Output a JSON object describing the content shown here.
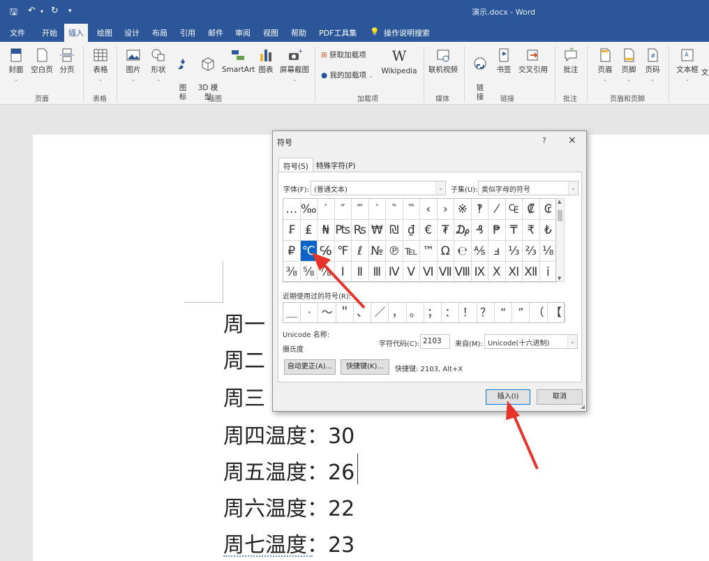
{
  "window": {
    "title": "演示.docx  -  Word",
    "quick_access": [
      "save-icon",
      "undo-icon",
      "redo-icon",
      "customize-icon"
    ]
  },
  "ribbon": {
    "tabs": [
      "文件",
      "开始",
      "插入",
      "绘图",
      "设计",
      "布局",
      "引用",
      "邮件",
      "审阅",
      "视图",
      "帮助",
      "PDF工具集",
      "操作说明搜索"
    ],
    "active_tab": "插入",
    "buttons": {
      "cover": "封面",
      "blank_page": "空白页",
      "page_break": "分页",
      "table": "表格",
      "picture": "图片",
      "shapes": "形状",
      "icons": "图\n标",
      "model3d": "3D 模\n型",
      "smartart": "SmartArt",
      "chart": "图表",
      "screenshot": "屏幕截图",
      "get_addins": "获取加载项",
      "my_addins": "我的加载项",
      "wikipedia": "Wikipedia",
      "online_video": "联机视频",
      "link": "链\n接",
      "bookmark": "书签",
      "cross_ref": "交叉引用",
      "comment": "批注",
      "header": "页眉",
      "footer": "页脚",
      "page_number": "页码",
      "textbox": "文本框",
      "more": "文"
    },
    "groups": {
      "pages": "页面",
      "tables": "表格",
      "illustrations": "插图",
      "addins": "加载项",
      "media": "媒体",
      "links": "链接",
      "comments": "批注",
      "header_footer": "页眉和页脚"
    }
  },
  "document": {
    "lines": [
      {
        "text": "周一温度：",
        "partial": "周一"
      },
      {
        "text": "周二温度：",
        "partial": "周二"
      },
      {
        "text": "周三温度：",
        "partial": "周三"
      },
      {
        "text": "周四温度：30"
      },
      {
        "text": "周五温度：26"
      },
      {
        "text": "周六温度：22"
      },
      {
        "text": "周七温度：23"
      }
    ]
  },
  "dialog": {
    "title": "符号",
    "help": "?",
    "close": "×",
    "tabs": [
      "符号(S)",
      "特殊字符(P)"
    ],
    "font_label": "字体(F):",
    "font_value": "(普通文本)",
    "subset_label": "子集(U):",
    "subset_value": "类似字母的符号",
    "symbols": [
      [
        "…",
        "‰",
        "′",
        "″",
        "‴",
        "‵",
        "‶",
        "‷",
        "‹",
        "›",
        "※",
        "‽",
        "⁄",
        "₠",
        "₡",
        "₢"
      ],
      [
        "₣",
        "₤",
        "₦",
        "₧",
        "₨",
        "₩",
        "₪",
        "₫",
        "€",
        "₮",
        "₯",
        "₰",
        "₱",
        "₸",
        "₹",
        "₺"
      ],
      [
        "₽",
        "℃",
        "℅",
        "℉",
        "ℓ",
        "№",
        "℗",
        "℡",
        "™",
        "Ω",
        "℮",
        "⅍",
        "ⅎ",
        "⅓",
        "⅔",
        "⅛"
      ],
      [
        "⅜",
        "⅝",
        "⅞",
        "Ⅰ",
        "Ⅱ",
        "Ⅲ",
        "Ⅳ",
        "Ⅴ",
        "Ⅵ",
        "Ⅶ",
        "Ⅷ",
        "Ⅸ",
        "Ⅹ",
        "Ⅺ",
        "Ⅻ",
        "ⅰ"
      ]
    ],
    "selected_symbol": "℃",
    "recent_label": "近期使用过的符号(R):",
    "recent": [
      "＿",
      "·",
      "～",
      "＂",
      "、",
      "／",
      "，",
      "。",
      "；",
      "：",
      "！",
      "？",
      "“",
      "”",
      "（",
      "【"
    ],
    "unicode_name_label": "Unicode 名称:",
    "unicode_name": "摄氏度",
    "char_code_label": "字符代码(C):",
    "char_code": "2103",
    "from_label": "来自(M):",
    "from_value": "Unicode(十六进制)",
    "autocorrect_btn": "自动更正(A)...",
    "shortcut_btn": "快捷键(K)...",
    "shortcut_text": "快捷键: 2103, Alt+X",
    "insert_btn": "插入(I)",
    "cancel_btn": "取消"
  },
  "colors": {
    "brand": "#2b579a",
    "selection": "#0a64c8",
    "annotation_arrow": "#e8332a"
  }
}
